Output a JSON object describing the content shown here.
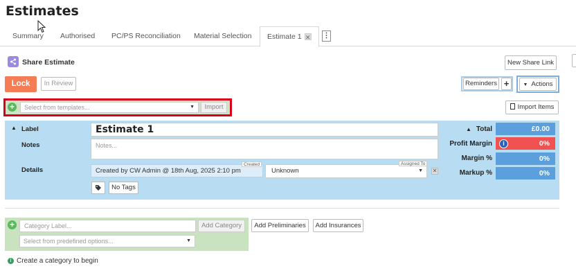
{
  "page": {
    "title": "Estimates"
  },
  "tabs": [
    {
      "label": "Summary"
    },
    {
      "label": "Authorised"
    },
    {
      "label": "PC/PS Reconciliation"
    },
    {
      "label": "Material Selection"
    },
    {
      "label": "Estimate 1",
      "active": true,
      "close": "✕"
    }
  ],
  "tab_more": "⋮",
  "share": {
    "label": "Share Estimate",
    "new_link": "New Share Link"
  },
  "toolbar": {
    "lock": "Lock",
    "in_review": "In Review",
    "reminders": "Reminders",
    "plus": "+",
    "actions": "Actions",
    "actions_caret": "▼"
  },
  "template": {
    "placeholder": "Select from templates...",
    "import": "Import",
    "import_items": "Import Items"
  },
  "estimate": {
    "label_caption": "Label",
    "name": "Estimate 1",
    "notes_caption": "Notes",
    "notes_placeholder": "Notes...",
    "details_caption": "Details",
    "created_tag": "Created",
    "created_text": "Created by  CW Admin @ 18th Aug, 2025 2:10 pm",
    "assigned_tag": "Assigned To",
    "assigned_value": "Unknown",
    "no_tags": "No Tags"
  },
  "summary": {
    "total_label": "Total",
    "total_value": "£0.00",
    "profit_margin_label": "Profit Margin",
    "profit_margin_value": "0%",
    "margin_pct_label": "Margin %",
    "margin_pct_value": "0%",
    "markup_pct_label": "Markup %",
    "markup_pct_value": "0%"
  },
  "category": {
    "label_placeholder": "Category Label...",
    "add_category": "Add Category",
    "predefined_placeholder": "Select from predefined options...",
    "add_preliminaries": "Add Preliminaries",
    "add_insurances": "Add Insurances",
    "hint": "Create a category to begin"
  },
  "colors": {
    "lock": "#f47d56",
    "panel": "#b8dcf2",
    "value_box": "#5ba0dc",
    "profit_margin_box": "#f05252",
    "template_highlight": "#d9001b",
    "category_panel": "#c9e3c0"
  }
}
